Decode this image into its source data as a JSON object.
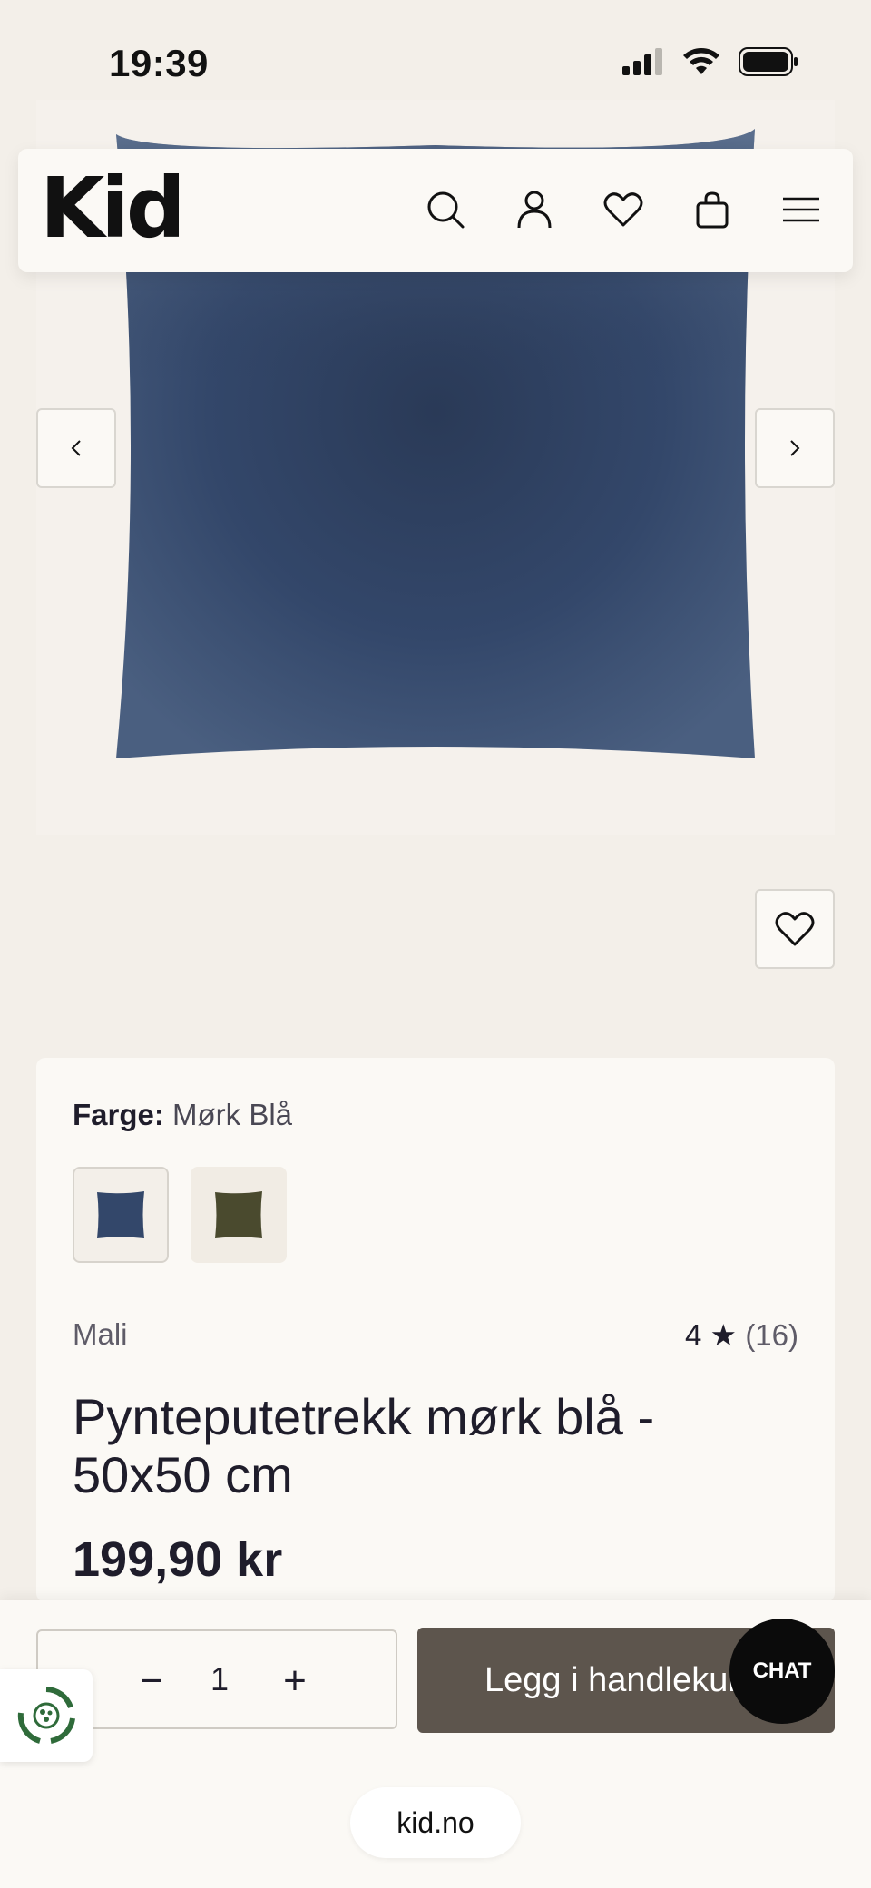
{
  "status_bar": {
    "time": "19:39"
  },
  "header": {
    "logo": "Kid",
    "icons": [
      "search-icon",
      "user-icon",
      "heart-icon",
      "bag-icon",
      "menu-icon"
    ]
  },
  "product": {
    "color_label": "Farge:",
    "color_value": "Mørk Blå",
    "swatches": [
      {
        "name": "Mørk Blå",
        "color": "#2e3f5c",
        "selected": true
      },
      {
        "name": "Grønn",
        "color": "#4a4a2e",
        "selected": false
      }
    ],
    "brand": "Mali",
    "rating_value": "4",
    "rating_star": "★",
    "rating_count": "(16)",
    "title": "Pynteputetrekk mørk blå - 50x50 cm",
    "price": "199,90 kr"
  },
  "cart": {
    "minus": "−",
    "quantity": "1",
    "plus": "+",
    "add_label": "Legg i handlekurv"
  },
  "chat": {
    "label": "CHAT"
  },
  "browser": {
    "url": "kid.no"
  },
  "colors": {
    "background": "#f3efe9",
    "card": "#fbf9f5",
    "button": "#5d554d",
    "chat": "#0b0b0b",
    "pillow": "#2e3f5c"
  }
}
